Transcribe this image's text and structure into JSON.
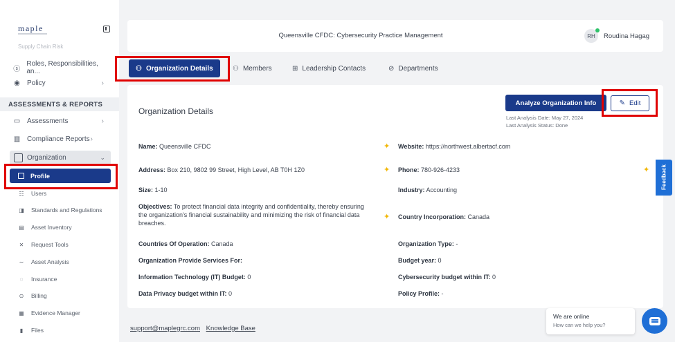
{
  "sidebar": {
    "logo": "maple",
    "faded_item": "Supply Chain Risk",
    "roles_item": "Roles, Responsibilities, an...",
    "policy_item": "Policy",
    "section_header": "ASSESSMENTS & REPORTS",
    "assessments_item": "Assessments",
    "compliance_item": "Compliance Reports",
    "organization_item": "Organization",
    "profile_item": "Profile",
    "sub_items": [
      "Users",
      "Standards and Regulations",
      "Asset Inventory",
      "Request Tools",
      "Asset Analysis",
      "Insurance",
      "Billing",
      "Evidence Manager",
      "Files"
    ]
  },
  "header": {
    "title": "Queensville CFDC: Cybersecurity Practice Management",
    "avatar_initials": "RH",
    "user_name": "Roudina Hagag"
  },
  "tabs": [
    {
      "label": "Organization Details"
    },
    {
      "label": "Members"
    },
    {
      "label": "Leadership Contacts"
    },
    {
      "label": "Departments"
    }
  ],
  "card": {
    "title": "Organization Details",
    "analyze_label": "Analyze Organization Info",
    "edit_label": "Edit",
    "last_analysis_date": "Last Analysis Date: May 27, 2024",
    "last_analysis_status": "Last Analysis Status: Done"
  },
  "fields": {
    "name": {
      "label": "Name:",
      "value": "Queensville CFDC"
    },
    "website": {
      "label": "Website:",
      "value": "https://northwest.albertacf.com"
    },
    "address": {
      "label": "Address:",
      "value": "Box 210, 9802 99 Street, High Level, AB T0H 1Z0"
    },
    "phone": {
      "label": "Phone:",
      "value": "780-926-4233"
    },
    "size": {
      "label": "Size:",
      "value": "1-10"
    },
    "industry": {
      "label": "Industry:",
      "value": "Accounting"
    },
    "objectives": {
      "label": "Objectives:",
      "value": "To protect financial data integrity and confidentiality, thereby ensuring the organization's financial sustainability and minimizing the risk of financial data breaches."
    },
    "country_incorporation": {
      "label": "Country Incorporation:",
      "value": "Canada"
    },
    "countries_operation": {
      "label": "Countries Of Operation:",
      "value": "Canada"
    },
    "organization_type": {
      "label": "Organization Type:",
      "value": "-"
    },
    "provide_services": {
      "label": "Organization Provide Services For:",
      "value": ""
    },
    "budget_year": {
      "label": "Budget year:",
      "value": "0"
    },
    "it_budget": {
      "label": "Information Technology (IT) Budget:",
      "value": "0"
    },
    "cyber_budget": {
      "label": "Cybersecurity budget within IT:",
      "value": "0"
    },
    "privacy_budget": {
      "label": "Data Privacy budget within IT:",
      "value": "0"
    },
    "policy_profile": {
      "label": "Policy Profile:",
      "value": "-"
    }
  },
  "feedback_label": "Feedback",
  "footer": {
    "email": "support@maplegrc.com",
    "kb": "Knowledge Base"
  },
  "chat": {
    "title": "We are online",
    "subtitle": "How can we help you?"
  },
  "colors": {
    "primary": "#1a3a8a",
    "highlight": "#e00000",
    "sparkle": "#f2b705",
    "feedback": "#1f6fd6"
  }
}
